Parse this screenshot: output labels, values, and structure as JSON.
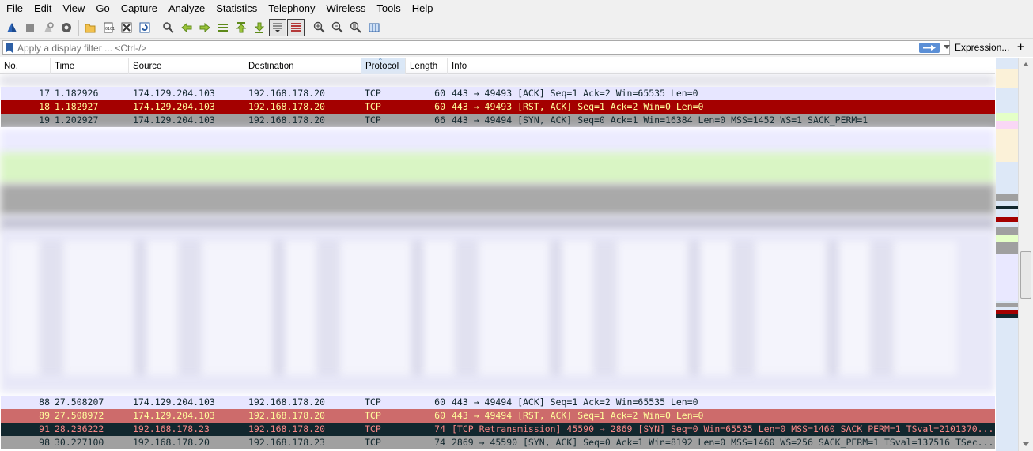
{
  "menu": [
    {
      "label": "File",
      "u": "F",
      "rest": "ile"
    },
    {
      "label": "Edit",
      "u": "E",
      "rest": "dit"
    },
    {
      "label": "View",
      "u": "V",
      "rest": "iew"
    },
    {
      "label": "Go",
      "u": "G",
      "rest": "o"
    },
    {
      "label": "Capture",
      "u": "C",
      "rest": "apture"
    },
    {
      "label": "Analyze",
      "u": "A",
      "rest": "nalyze"
    },
    {
      "label": "Statistics",
      "u": "S",
      "rest": "tatistics"
    },
    {
      "label": "Telephony",
      "u": "",
      "rest": "Telephony"
    },
    {
      "label": "Wireless",
      "u": "W",
      "rest": "ireless"
    },
    {
      "label": "Tools",
      "u": "T",
      "rest": "ools"
    },
    {
      "label": "Help",
      "u": "H",
      "rest": "elp"
    }
  ],
  "filter": {
    "placeholder": "Apply a display filter ... <Ctrl-/>",
    "expression_label": "Expression...",
    "plus_label": "+"
  },
  "columns": [
    "No.",
    "Time",
    "Source",
    "Destination",
    "Protocol",
    "Length",
    "Info"
  ],
  "sorted_column": "Protocol",
  "rows_top": [
    {
      "no": "17",
      "time": "1.182926",
      "src": "174.129.204.103",
      "dst": "192.168.178.20",
      "proto": "TCP",
      "len": "60",
      "info": "443 → 49493 [ACK] Seq=1 Ack=2 Win=65535 Len=0",
      "bg": "#e7e6ff",
      "fg": "#12272e"
    },
    {
      "no": "18",
      "time": "1.182927",
      "src": "174.129.204.103",
      "dst": "192.168.178.20",
      "proto": "TCP",
      "len": "60",
      "info": "443 → 49493 [RST, ACK] Seq=1 Ack=2 Win=0 Len=0",
      "bg": "#a40000",
      "fg": "#fffc9c"
    },
    {
      "no": "19",
      "time": "1.202927",
      "src": "174.129.204.103",
      "dst": "192.168.178.20",
      "proto": "TCP",
      "len": "66",
      "info": "443 → 49494 [SYN, ACK] Seq=0 Ack=1 Win=16384 Len=0 MSS=1452 WS=1 SACK_PERM=1",
      "bg": "#a0a0a0",
      "fg": "#12272e"
    }
  ],
  "rows_bottom": [
    {
      "no": "88",
      "time": "27.508207",
      "src": "174.129.204.103",
      "dst": "192.168.178.20",
      "proto": "TCP",
      "len": "60",
      "info": "443 → 49494 [ACK] Seq=1 Ack=2 Win=65535 Len=0",
      "bg": "#e7e6ff",
      "fg": "#12272e"
    },
    {
      "no": "89",
      "time": "27.508972",
      "src": "174.129.204.103",
      "dst": "192.168.178.20",
      "proto": "TCP",
      "len": "60",
      "info": "443 → 49494 [RST, ACK] Seq=1 Ack=2 Win=0 Len=0",
      "bg": "#cd6b6b",
      "fg": "#fffc9c"
    },
    {
      "no": "91",
      "time": "28.236222",
      "src": "192.168.178.23",
      "dst": "192.168.178.20",
      "proto": "TCP",
      "len": "74",
      "info": "[TCP Retransmission] 45590 → 2869 [SYN] Seq=0 Win=65535 Len=0 MSS=1460 SACK_PERM=1 TSval=2101370...",
      "bg": "#12272e",
      "fg": "#f78787"
    },
    {
      "no": "98",
      "time": "30.227100",
      "src": "192.168.178.20",
      "dst": "192.168.178.23",
      "proto": "TCP",
      "len": "74",
      "info": "2869 → 45590 [SYN, ACK] Seq=0 Ack=1 Win=8192 Len=0 MSS=1460 WS=256 SACK_PERM=1 TSval=137516 TSec...",
      "bg": "#a0a0a0",
      "fg": "#12272e"
    }
  ],
  "colors": {
    "ack_row": "#e7e6ff",
    "rst_row": "#a40000",
    "synack_row": "#a0a0a0",
    "retrans_row": "#12272e",
    "rst_row_light": "#cd6b6b",
    "http_green": "#e4ffc7"
  }
}
